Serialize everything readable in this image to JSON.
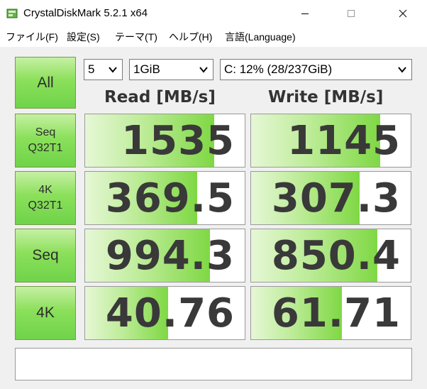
{
  "window": {
    "title": "CrystalDiskMark 5.2.1 x64"
  },
  "menu": [
    "ファイル(F)",
    "設定(S)",
    "テーマ(T)",
    "ヘルプ(H)",
    "言語(Language)"
  ],
  "controls": {
    "all_label": "All",
    "count": "5",
    "size": "1GiB",
    "drive": "C: 12% (28/237GiB)"
  },
  "headers": {
    "read": "Read [MB/s]",
    "write": "Write [MB/s]"
  },
  "tests": [
    {
      "label_lines": [
        "Seq",
        "Q32T1"
      ],
      "read": "1535",
      "write": "1145",
      "read_fill": 0.81,
      "write_fill": 0.81
    },
    {
      "label_lines": [
        "4K",
        "Q32T1"
      ],
      "read": "369.5",
      "write": "307.3",
      "read_fill": 0.7,
      "write_fill": 0.68
    },
    {
      "label_lines": [
        "Seq"
      ],
      "read": "994.3",
      "write": "850.4",
      "read_fill": 0.78,
      "write_fill": 0.79
    },
    {
      "label_lines": [
        "4K"
      ],
      "read": "40.76",
      "write": "61.71",
      "read_fill": 0.52,
      "write_fill": 0.57
    }
  ],
  "status": {
    "text": ""
  },
  "colors": {
    "button_green": "#7fd844",
    "bar_green": "#7fd844",
    "value_text": "#393939"
  }
}
